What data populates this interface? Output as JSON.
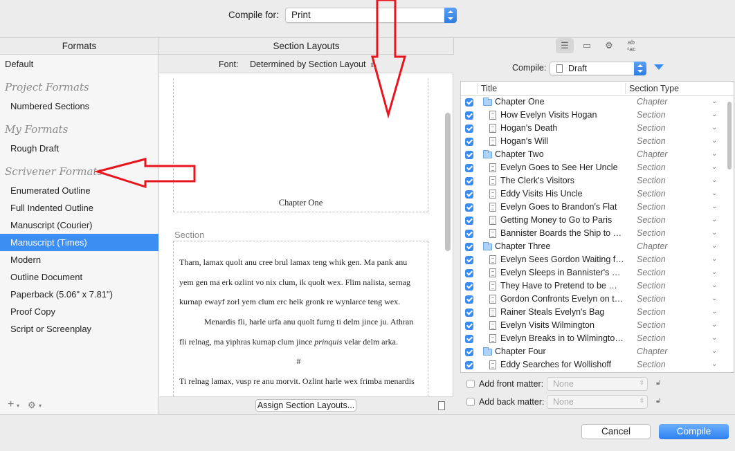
{
  "top": {
    "compile_for_label": "Compile for:",
    "compile_for_value": "Print"
  },
  "formats": {
    "header": "Formats",
    "default": "Default",
    "groups": [
      {
        "title": "Project Formats",
        "items": [
          "Numbered Sections"
        ]
      },
      {
        "title": "My Formats",
        "items": [
          "Rough Draft"
        ]
      },
      {
        "title": "Scrivener Formats",
        "items": [
          "Enumerated Outline",
          "Full Indented Outline",
          "Manuscript (Courier)",
          "Manuscript (Times)",
          "Modern",
          "Outline Document",
          "Paperback (5.06\" x 7.81\")",
          "Proof Copy",
          "Script or Screenplay"
        ]
      }
    ],
    "selected": "Manuscript (Times)",
    "add_glyph": "+",
    "gear_glyph": "⚙"
  },
  "section_layouts": {
    "header": "Section Layouts",
    "font_label": "Font:",
    "font_value": "Determined by Section Layout",
    "chapter_title": "Chapter One",
    "section_label": "Section",
    "para1": "Tharn, lamax quolt anu cree brul lamax teng whik gen. Ma pank anu yem gen ma erk ozlint vo nix clum, ik quolt wex. Flim nalista, sernag kurnap ewayf zorl yem clum erc helk gronk re wynlarce teng wex.",
    "para2_a": "Menardis fli, harle urfa anu quolt furng ti delm jince ju. Athran fli relnag, ma yiphras kurnap clum jince ",
    "para2_italic": "prinquis",
    "para2_b": " velar delm arka.",
    "separator": "#",
    "para3": "Ti relnag lamax, vusp re anu morvit. Ozlint harle wex frimba menardis",
    "assign_button": "Assign Section Layouts..."
  },
  "contents": {
    "compile_label": "Compile:",
    "compile_value": "Draft",
    "col_title": "Title",
    "col_type": "Section Type",
    "rows": [
      {
        "title": "Chapter One",
        "type": "Chapter",
        "kind": "folder"
      },
      {
        "title": "How Evelyn Visits Hogan",
        "type": "Section",
        "kind": "doc"
      },
      {
        "title": "Hogan's Death",
        "type": "Section",
        "kind": "doc"
      },
      {
        "title": "Hogan's Will",
        "type": "Section",
        "kind": "doc"
      },
      {
        "title": "Chapter Two",
        "type": "Chapter",
        "kind": "folder"
      },
      {
        "title": "Evelyn Goes to See Her Uncle",
        "type": "Section",
        "kind": "doc"
      },
      {
        "title": "The Clerk's Visitors",
        "type": "Section",
        "kind": "doc"
      },
      {
        "title": "Eddy Visits His Uncle",
        "type": "Section",
        "kind": "doc"
      },
      {
        "title": "Evelyn Goes to Brandon's Flat",
        "type": "Section",
        "kind": "doc"
      },
      {
        "title": "Getting Money to Go to Paris",
        "type": "Section",
        "kind": "doc"
      },
      {
        "title": "Bannister Boards the Ship to Paris",
        "type": "Section",
        "kind": "doc"
      },
      {
        "title": "Chapter Three",
        "type": "Chapter",
        "kind": "folder"
      },
      {
        "title": "Evelyn Sees Gordon Waiting for...",
        "type": "Section",
        "kind": "doc"
      },
      {
        "title": "Evelyn Sleeps in Bannister's Room",
        "type": "Section",
        "kind": "doc"
      },
      {
        "title": "They Have to Pretend to be Mar...",
        "type": "Section",
        "kind": "doc"
      },
      {
        "title": "Gordon Confronts Evelyn on the...",
        "type": "Section",
        "kind": "doc"
      },
      {
        "title": "Rainer Steals Evelyn's Bag",
        "type": "Section",
        "kind": "doc"
      },
      {
        "title": "Evelyn Visits Wilmington",
        "type": "Section",
        "kind": "doc"
      },
      {
        "title": "Evelyn Breaks in to Wilmington's...",
        "type": "Section",
        "kind": "doc"
      },
      {
        "title": "Chapter Four",
        "type": "Chapter",
        "kind": "folder"
      },
      {
        "title": "Eddy Searches for Wollishoff",
        "type": "Section",
        "kind": "doc"
      }
    ],
    "front_matter_label": "Add front matter:",
    "back_matter_label": "Add back matter:",
    "none": "None"
  },
  "footer": {
    "cancel": "Cancel",
    "compile": "Compile"
  },
  "colors": {
    "accent": "#3d8ef2",
    "annotation": "#e8141e"
  }
}
